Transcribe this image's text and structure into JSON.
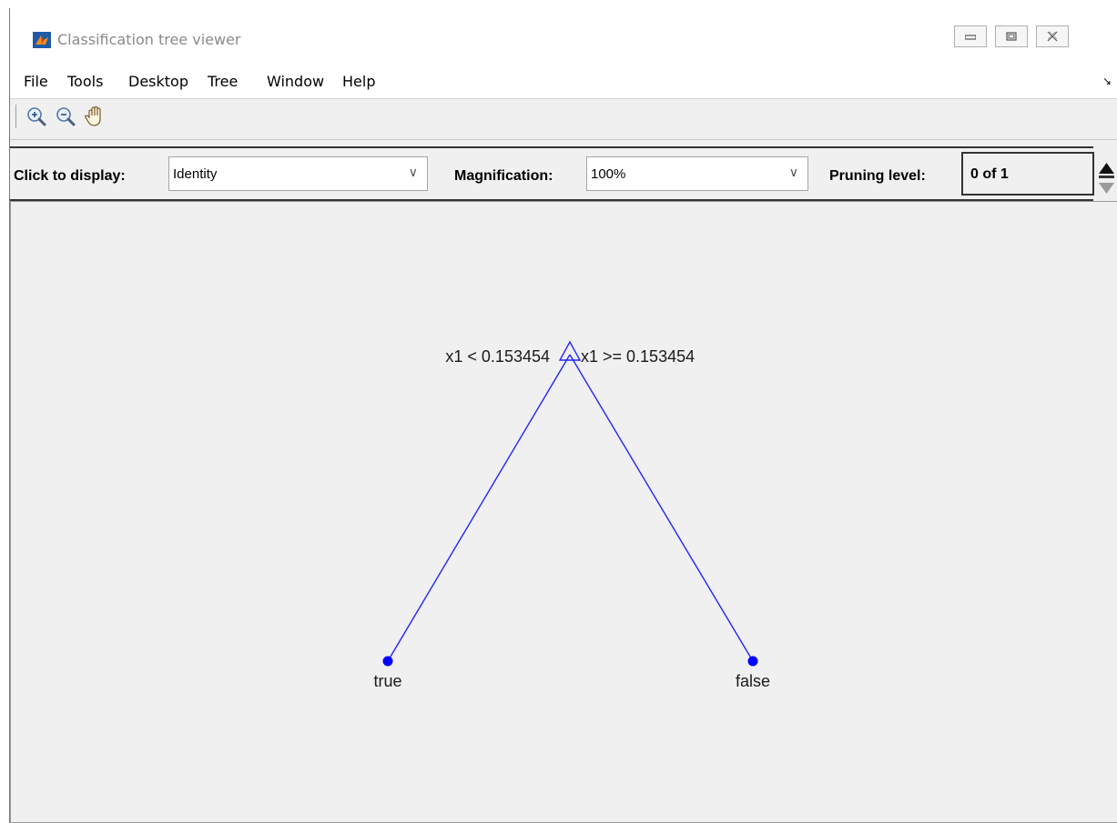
{
  "window": {
    "title": "Classification tree viewer",
    "minimize_icon": "minimize-icon",
    "maximize_icon": "maximize-icon",
    "close_icon": "close-icon"
  },
  "menu": {
    "items": [
      "File",
      "Tools",
      "Desktop",
      "Tree",
      "Window",
      "Help"
    ]
  },
  "toolbar": {
    "icons": [
      "zoom-in-icon",
      "zoom-out-icon",
      "pan-hand-icon"
    ]
  },
  "controls": {
    "click_to_display_label": "Click to display:",
    "click_to_display_value": "Identity",
    "magnification_label": "Magnification:",
    "magnification_value": "100%",
    "pruning_label": "Pruning level:",
    "pruning_value": "0 of 1"
  },
  "tree": {
    "root": {
      "left_rule": "x1 < 0.153454",
      "right_rule": "x1 >= 0.153454"
    },
    "leaves": [
      {
        "label": "true"
      },
      {
        "label": "false"
      }
    ],
    "colors": {
      "branch": "#2424ff",
      "leaf": "#0000ff"
    }
  }
}
